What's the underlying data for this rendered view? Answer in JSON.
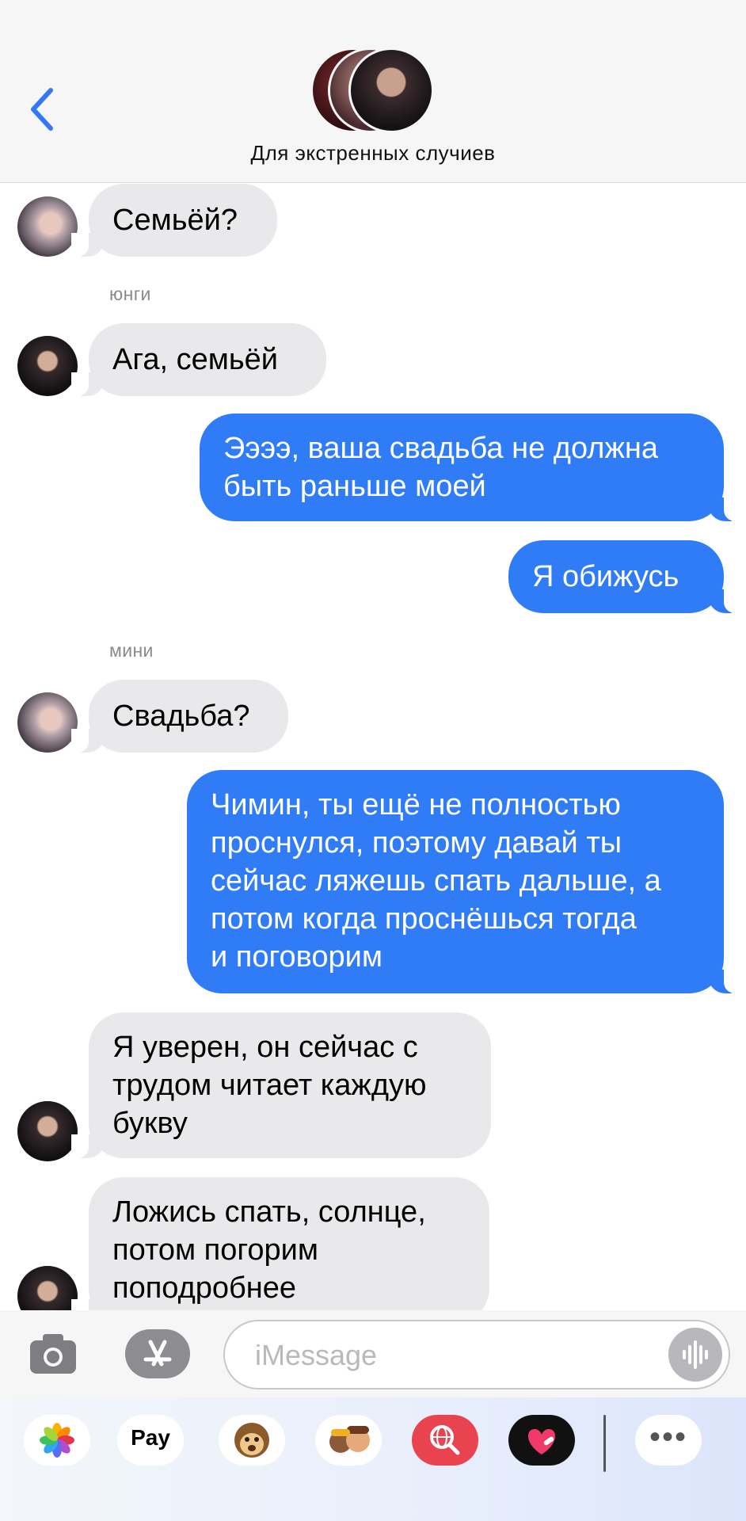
{
  "header": {
    "title": "Для экстренных случиев",
    "back_icon": "chevron-left-icon",
    "accent": "#3478f6"
  },
  "messages": [
    {
      "dir": "in",
      "text": "Семьёй?"
    },
    {
      "sender": "юнги"
    },
    {
      "dir": "in",
      "text": "Ага, семьёй"
    },
    {
      "dir": "out",
      "lines": [
        "Ээээ, ваша свадьба не должна",
        "быть раньше моей"
      ]
    },
    {
      "dir": "out",
      "text": "Я обижусь"
    },
    {
      "sender": "мини"
    },
    {
      "dir": "in",
      "text": "Свадьба?"
    },
    {
      "dir": "out",
      "lines": [
        "Чимин, ты ещё не полностью",
        "проснулся, поэтому давай ты",
        "сейчас ляжешь спать дальше, а",
        "потом когда проснёшься тогда",
        "и поговорим"
      ]
    },
    {
      "dir": "in",
      "lines": [
        "Я уверен, он сейчас с",
        "трудом читает каждую",
        "букву"
      ]
    },
    {
      "dir": "in",
      "lines": [
        "Ложись спать, солнце,",
        "потом погорим",
        "поподробнее"
      ]
    }
  ],
  "compose": {
    "placeholder": "iMessage",
    "camera_icon": "camera-icon",
    "apps_icon": "app-store-icon",
    "voice_icon": "waveform-icon"
  },
  "drawer": {
    "apps": [
      "photos-icon",
      "apple-pay-icon",
      "animoji-icon",
      "memoji-icon",
      "web-search-icon",
      "digital-touch-icon",
      "more-icon"
    ],
    "applepay_label": "Pay"
  },
  "colors": {
    "incoming": "#e9e9eb",
    "outgoing": "#2f7cf6"
  }
}
